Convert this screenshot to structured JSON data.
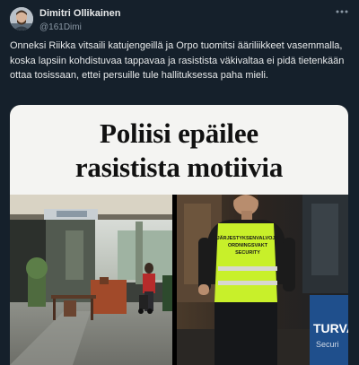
{
  "author": {
    "display_name": "Dimitri Ollikainen",
    "handle": "@161Dimi",
    "avatar_icon": "avatar-photo"
  },
  "menu": {
    "icon": "more-options-icon",
    "label": "···"
  },
  "tweet": {
    "text": "Onneksi Riikka vitsaili katujengeillä ja Orpo tuomitsi ääriliikkeet vasemmalla, koska lapsiin kohdistuvaa tappavaa ja rasistista väkivaltaa ei pidä tietenkään ottaa tosissaan, ettei persuille tule hallituksessa paha mieli."
  },
  "media": {
    "headline": [
      "Poliisi epäilee",
      "rasistista motiivia"
    ],
    "vest_lines": [
      "JÄRJESTYKSENVALVOJA",
      "ORDNINGSVAKT",
      "SECURITY"
    ],
    "sign_text": "TURVA",
    "sign_subtext": "Securi"
  }
}
